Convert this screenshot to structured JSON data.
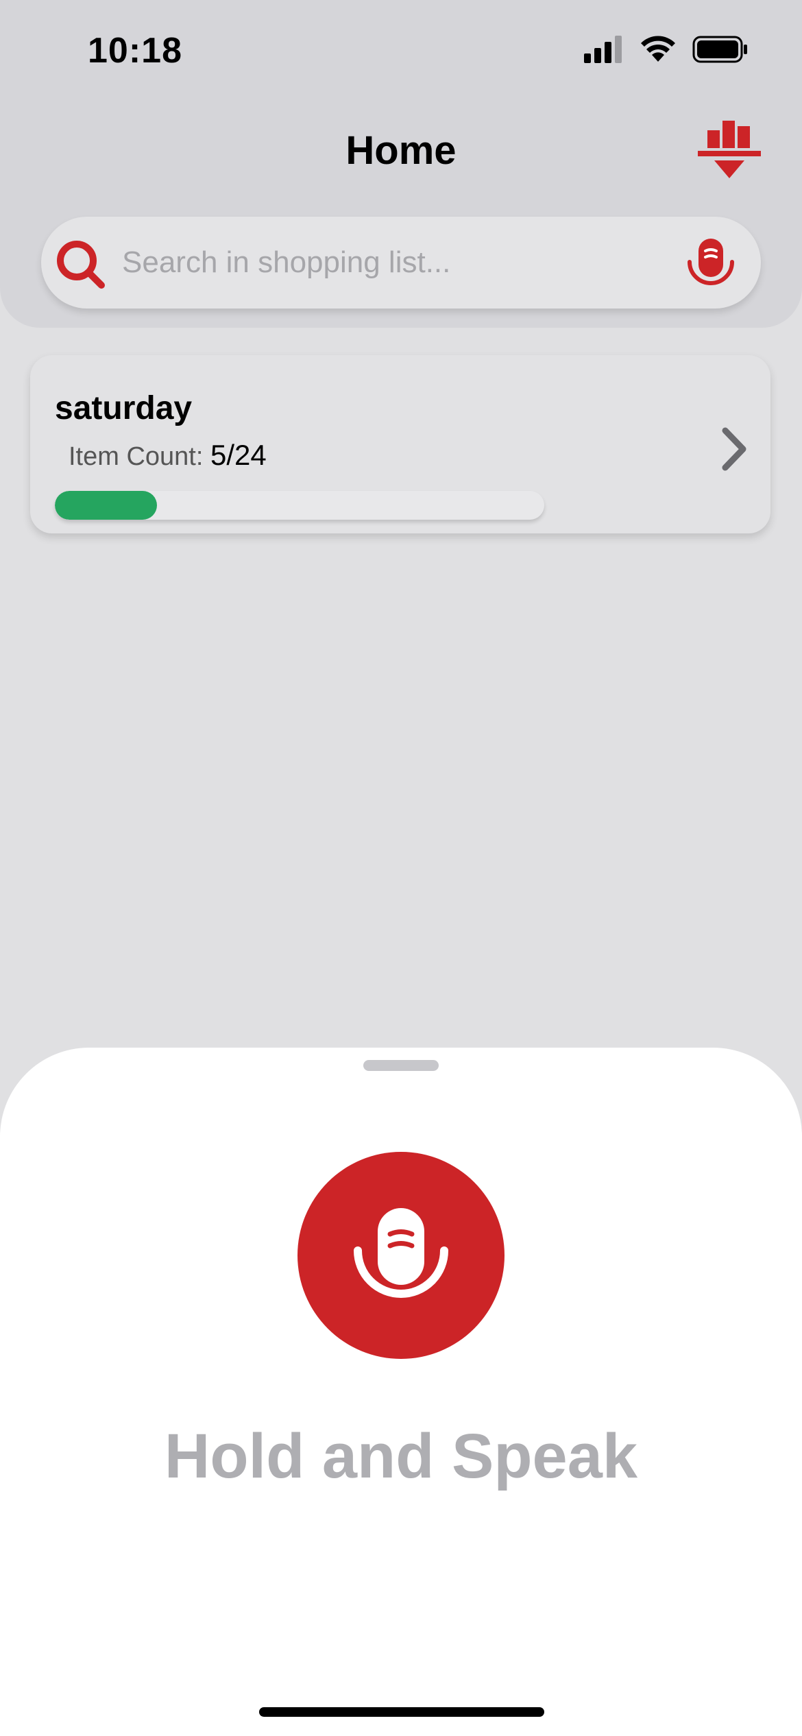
{
  "status_bar": {
    "time": "10:18",
    "icons": [
      "cellular-signal-icon",
      "wifi-icon",
      "battery-icon"
    ]
  },
  "header": {
    "title": "Home",
    "filter_icon": "filter-chart-icon"
  },
  "search": {
    "placeholder": "Search in shopping list...",
    "value": "",
    "search_icon": "search-icon",
    "mic_icon": "microphone-icon"
  },
  "lists": [
    {
      "name": "saturday",
      "item_count_label": "Item Count:",
      "item_count_value": "5/24",
      "progress": 0.2083
    }
  ],
  "voice_sheet": {
    "mic_icon": "microphone-icon",
    "label": "Hold and Speak"
  },
  "colors": {
    "accent": "#cc2427",
    "progress": "#25a55f",
    "header_bg": "#d5d5d9",
    "page_bg": "#e0e0e2",
    "sheet_bg": "#ffffff",
    "label_gray": "#aeaeb2"
  }
}
